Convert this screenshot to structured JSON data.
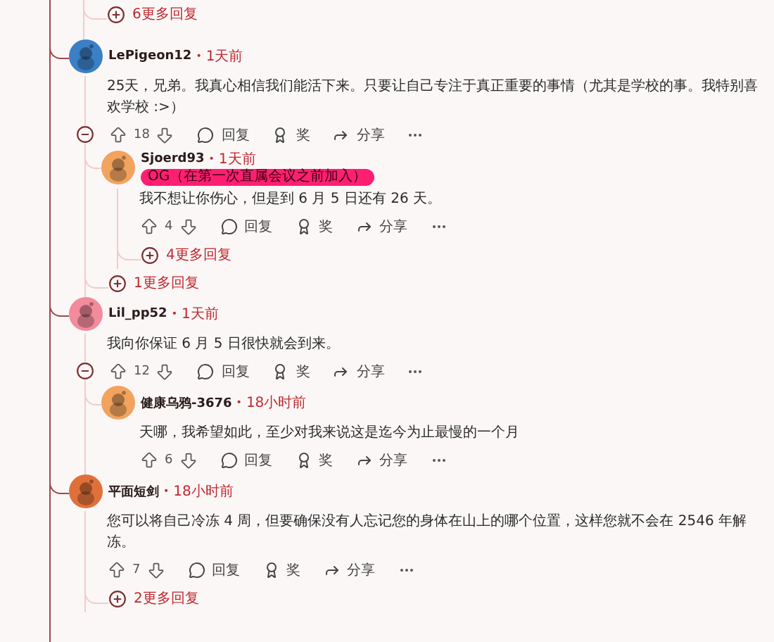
{
  "top_more_replies": "6更多回复",
  "comments": [
    {
      "user": "LePigeon12",
      "separator": "•",
      "time": "1天前",
      "color": "#3b7fc4",
      "body": "25天，兄弟。我真心相信我们能活下来。只要让自己专注于真正重要的事情（尤其是学校的事。我特别喜欢学校 :>）",
      "votes": "18",
      "expanded": true,
      "actions": [
        {
          "kind": "reply",
          "label": "回复"
        },
        {
          "kind": "award",
          "label": "奖"
        },
        {
          "kind": "share",
          "label": "分享"
        }
      ],
      "children": [
        {
          "user": "Sjoerd93",
          "separator": "•",
          "time": "1天前",
          "color": "#f2a35e",
          "flair": "OG（在第一次直属会议之前加入）",
          "body": "我不想让你伤心，但是到 6 月 5 日还有 26 天。",
          "votes": "4",
          "actions": [
            {
              "kind": "reply",
              "label": "回复"
            },
            {
              "kind": "award",
              "label": "奖"
            },
            {
              "kind": "share",
              "label": "分享"
            }
          ],
          "more_replies": "4更多回复"
        }
      ],
      "more_replies": "1更多回复"
    },
    {
      "user": "Lil_pp52",
      "separator": "•",
      "time": "1天前",
      "color": "#f28b9b",
      "body": "我向你保证 6 月 5 日很快就会到来。",
      "votes": "12",
      "expanded": true,
      "actions": [
        {
          "kind": "reply",
          "label": "回复"
        },
        {
          "kind": "award",
          "label": "奖"
        },
        {
          "kind": "share",
          "label": "分享"
        }
      ],
      "children": [
        {
          "user": "健康乌鸦-3676",
          "separator": "•",
          "time": "18小时前",
          "color": "#f2a35e",
          "body": "天哪，我希望如此，至少对我来说这是迄今为止最慢的一个月",
          "votes": "6",
          "actions": [
            {
              "kind": "reply",
              "label": "回复"
            },
            {
              "kind": "award",
              "label": "奖"
            },
            {
              "kind": "share",
              "label": "分享"
            }
          ]
        }
      ]
    },
    {
      "user": "平面短剑",
      "separator": "•",
      "time": "18小时前",
      "color": "#e0703a",
      "body": "您可以将自己冷冻 4 周，但要确保没有人忘记您的身体在山上的哪个位置，这样您就不会在 2546 年解冻。",
      "votes": "7",
      "actions": [
        {
          "kind": "reply",
          "label": "回复"
        },
        {
          "kind": "award",
          "label": "奖"
        },
        {
          "kind": "share",
          "label": "分享"
        }
      ],
      "more_replies": "2更多回复"
    }
  ]
}
